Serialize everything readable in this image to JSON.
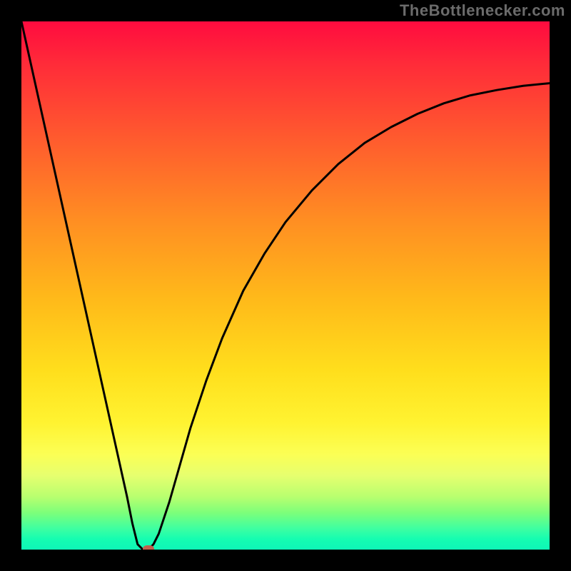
{
  "watermark": "TheBottlenecker.com",
  "chart_data": {
    "type": "line",
    "title": "",
    "xlabel": "",
    "ylabel": "",
    "xlim": [
      0,
      100
    ],
    "ylim": [
      0,
      100
    ],
    "x": [
      0,
      2,
      4,
      6,
      8,
      10,
      12,
      14,
      16,
      18,
      20,
      21,
      22,
      23,
      24,
      25,
      26,
      28,
      30,
      32,
      35,
      38,
      42,
      46,
      50,
      55,
      60,
      65,
      70,
      75,
      80,
      85,
      90,
      95,
      100
    ],
    "y": [
      100,
      91,
      82,
      73,
      64,
      55,
      46,
      37,
      28,
      19,
      10,
      5,
      1,
      0,
      0,
      1,
      3,
      9,
      16,
      23,
      32,
      40,
      49,
      56,
      62,
      68,
      73,
      77,
      80,
      82.5,
      84.5,
      86,
      87,
      87.8,
      88.3
    ],
    "marker": {
      "x": 24,
      "y": 0
    },
    "legend": false,
    "grid": false,
    "background": "red-yellow-green vertical gradient"
  }
}
